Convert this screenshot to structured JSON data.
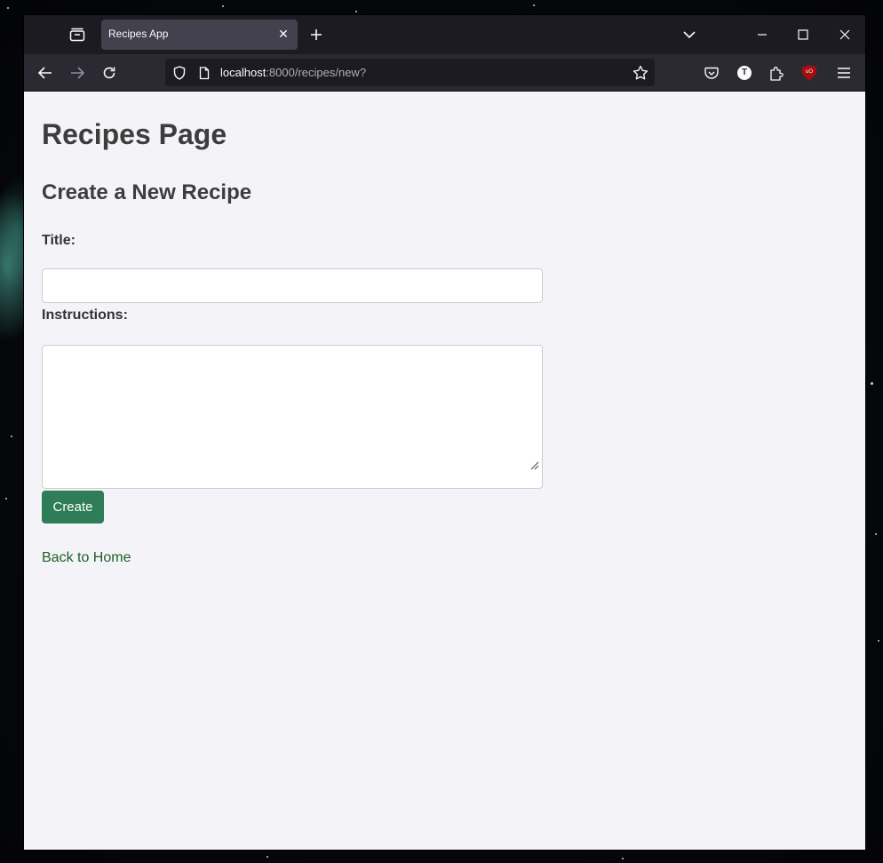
{
  "browser": {
    "tab_title": "Recipes App",
    "url_host": "localhost",
    "url_rest": ":8000/recipes/new?",
    "icons": {
      "tab_overview": "tab-overview-icon",
      "tab_close": "close-icon",
      "new_tab": "plus-icon",
      "list_tabs": "chevron-down-icon",
      "minimize": "minimize-icon",
      "maximize": "maximize-icon",
      "close_window": "close-icon",
      "back": "back-arrow-icon",
      "forward": "forward-arrow-icon",
      "reload": "reload-icon",
      "shield": "shield-icon",
      "page": "page-icon",
      "bookmark": "star-icon",
      "pocket": "pocket-icon",
      "account": "account-icon",
      "extensions": "puzzle-icon",
      "ublock": "ublock-icon",
      "menu": "hamburger-menu-icon"
    },
    "account_letter": "T",
    "ublock_text": "uO"
  },
  "page": {
    "heading": "Recipes Page",
    "form_heading": "Create a New Recipe",
    "title_label": "Title:",
    "title_value": "",
    "instructions_label": "Instructions:",
    "instructions_value": "",
    "create_button": "Create",
    "back_link": "Back to Home"
  },
  "colors": {
    "button": "#2e7d58",
    "link": "#1e5f24",
    "page_bg": "#f4f4f8"
  }
}
